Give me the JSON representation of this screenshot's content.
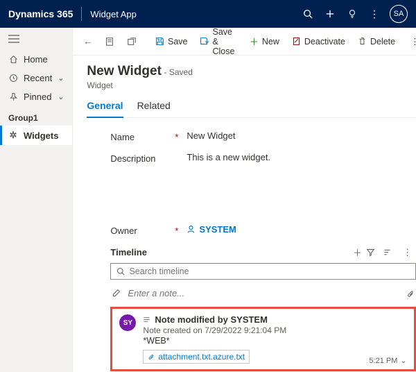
{
  "topbar": {
    "brand": "Dynamics 365",
    "app": "Widget App",
    "avatar": "SA"
  },
  "sidebar": {
    "home": "Home",
    "recent": "Recent",
    "pinned": "Pinned",
    "group": "Group1",
    "widgets": "Widgets"
  },
  "commands": {
    "save": "Save",
    "save_close": "Save & Close",
    "new": "New",
    "deactivate": "Deactivate",
    "delete": "Delete"
  },
  "record": {
    "title": "New Widget",
    "saved": "- Saved",
    "entity": "Widget"
  },
  "tabs": {
    "general": "General",
    "related": "Related"
  },
  "fields": {
    "name_label": "Name",
    "name_value": "New Widget",
    "description_label": "Description",
    "description_value": "This is a new widget.",
    "owner_label": "Owner",
    "owner_value": "SYSTEM"
  },
  "timeline": {
    "title": "Timeline",
    "search_placeholder": "Search timeline",
    "note_placeholder": "Enter a note...",
    "note": {
      "avatar": "SY",
      "title": "Note modified by SYSTEM",
      "created": "Note created on 7/29/2022 9:21:04 PM",
      "text": "*WEB*",
      "attachment": "attachment.txt.azure.txt",
      "time": "5:21 PM"
    }
  }
}
